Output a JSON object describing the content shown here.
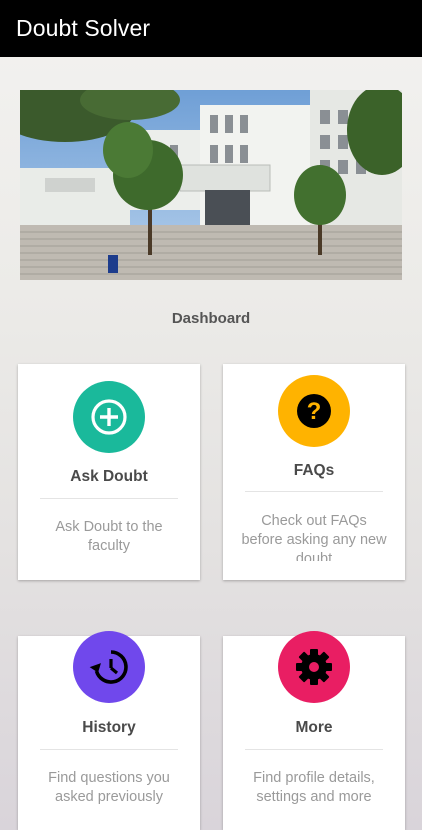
{
  "app_bar": {
    "title": "Doubt Solver"
  },
  "dashboard": {
    "label": "Dashboard"
  },
  "cards": [
    {
      "title": "Ask Doubt",
      "description": "Ask Doubt to the faculty",
      "icon": "plus-circle-icon",
      "color": "#1ab99b"
    },
    {
      "title": "FAQs",
      "description": "Check out FAQs before asking any new doubt",
      "icon": "question-icon",
      "color": "#ffb300"
    },
    {
      "title": "History",
      "description": "Find questions you asked previously",
      "icon": "history-icon",
      "color": "#7048ec"
    },
    {
      "title": "More",
      "description": "Find profile details, settings and more",
      "icon": "gear-icon",
      "color": "#e91e63"
    }
  ]
}
